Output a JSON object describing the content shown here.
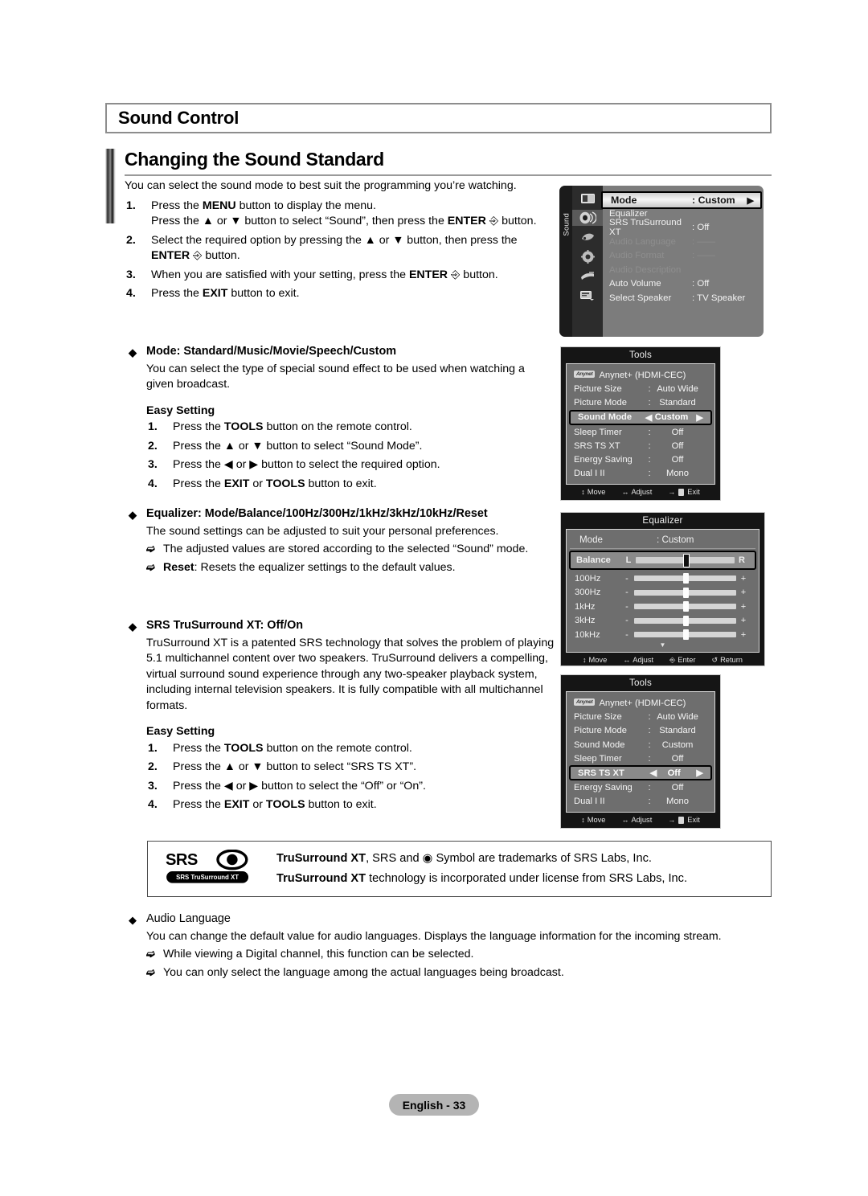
{
  "section": {
    "title": "Sound Control",
    "subtitle": "Changing the Sound Standard"
  },
  "intro": {
    "line": "You can select the sound mode to best suit the programming you’re watching.",
    "steps": [
      {
        "num": "1.",
        "line1_a": "Press the ",
        "line1_b": "MENU",
        "line1_c": " button to display the menu.",
        "line2_a": "Press the ▲ or ▼ button to select “Sound”, then press the ",
        "line2_b": "ENTER",
        "line2_c": " button."
      },
      {
        "num": "2.",
        "line1_a": "Select the required option by pressing the ▲ or ▼ button, then press the",
        "line2_b": "ENTER",
        "line2_c": " button."
      },
      {
        "num": "3.",
        "line1_a": "When you are satisfied with your setting, press the ",
        "line1_b": "ENTER",
        "line1_c": " button."
      },
      {
        "num": "4.",
        "line1_a": "Press the ",
        "line1_b": "EXIT",
        "line1_c": " button to exit."
      }
    ]
  },
  "bullets": {
    "mode": {
      "heading": "Mode: Standard/Music/Movie/Speech/Custom",
      "body": "You can select the type of special sound effect to be used when watching a given broadcast.",
      "easy_setting_label": "Easy Setting",
      "steps": [
        {
          "num": "1.",
          "a": "Press the ",
          "b": "TOOLS",
          "c": " button on the remote control."
        },
        {
          "num": "2.",
          "a": "Press the ▲ or ▼ button to select “Sound Mode”.",
          "b": "",
          "c": ""
        },
        {
          "num": "3.",
          "a": "Press the ◀ or ▶ button to select the required option.",
          "b": "",
          "c": ""
        },
        {
          "num": "4.",
          "a": "Press the ",
          "b": "EXIT",
          "mid": " or ",
          "b2": "TOOLS",
          "c": " button to exit."
        }
      ]
    },
    "equalizer": {
      "heading": "Equalizer: Mode/Balance/100Hz/300Hz/1kHz/3kHz/10kHz/Reset",
      "body": "The sound settings can be adjusted to suit your personal preferences.",
      "notes": [
        {
          "bold": "",
          "text": "The adjusted values are stored according to the selected “Sound” mode."
        },
        {
          "bold": "Reset",
          "text": ": Resets the equalizer settings to the default values."
        }
      ]
    },
    "srs": {
      "heading": "SRS TruSurround XT: Off/On",
      "body": "TruSurround XT is a patented SRS technology that solves the problem of playing 5.1 multichannel content over two speakers. TruSurround delivers a compelling, virtual surround sound experience through any two-speaker playback system, including internal television speakers. It is fully compatible with all multichannel formats.",
      "easy_setting_label": "Easy Setting",
      "steps": [
        {
          "num": "1.",
          "a": "Press the ",
          "b": "TOOLS",
          "c": " button on the remote control."
        },
        {
          "num": "2.",
          "a": "Press the ▲ or ▼ button to select “SRS TS XT”.",
          "b": "",
          "c": ""
        },
        {
          "num": "3.",
          "a": "Press the ◀ or ▶ button to select the “Off” or “On”.",
          "b": "",
          "c": ""
        },
        {
          "num": "4.",
          "a": "Press the ",
          "b": "EXIT",
          "mid": " or ",
          "b2": "TOOLS",
          "c": " button to exit."
        }
      ]
    },
    "audio_language": {
      "heading": "Audio Language",
      "body": "You can change the default value for audio languages. Displays the language information for the incoming stream.",
      "notes": [
        {
          "text": "While viewing a Digital channel, this function can be selected."
        },
        {
          "text": "You can only select the language among the actual languages being broadcast."
        }
      ]
    }
  },
  "srs_box": {
    "logo_top": "SRS",
    "logo_bottom": "SRS TruSurround XT",
    "line1_a": "TruSurround XT",
    "line1_b": ", SRS and ",
    "line1_c": " Symbol are trademarks of SRS Labs, Inc.",
    "line2_a": "TruSurround XT",
    "line2_b": " technology is incorporated under license from SRS Labs, Inc."
  },
  "osd": {
    "sound_menu": {
      "rail_label": "Sound",
      "rail_icons": [
        "picture-icon",
        "sound-icon",
        "channel-icon",
        "setup-icon",
        "input-icon",
        "support-icon"
      ],
      "rows": [
        {
          "label": "Mode",
          "value": ": Custom",
          "state": "highlight",
          "arrow": "▶"
        },
        {
          "label": "Equalizer",
          "value": "",
          "state": "normal"
        },
        {
          "label": "SRS TruSurround XT",
          "value": ": Off",
          "state": "normal"
        },
        {
          "label": "Audio Language",
          "value": ": ——",
          "state": "dim"
        },
        {
          "label": "Audio Format",
          "value": ": ——",
          "state": "dim"
        },
        {
          "label": "Audio Description",
          "value": "",
          "state": "dim"
        },
        {
          "label": "Auto Volume",
          "value": ": Off",
          "state": "normal"
        },
        {
          "label": "Select Speaker",
          "value": ": TV Speaker",
          "state": "normal"
        }
      ]
    },
    "tools_1": {
      "title": "Tools",
      "anynet_chip": "Anynet",
      "anynet_label": "Anynet+ (HDMI-CEC)",
      "rows": [
        {
          "label": "Picture Size",
          "sep": ":",
          "value": "Auto Wide",
          "state": "normal"
        },
        {
          "label": "Picture Mode",
          "sep": ":",
          "value": "Standard",
          "state": "normal"
        },
        {
          "label": "Sound Mode",
          "sep": "◀",
          "value": "Custom",
          "state": "selected",
          "right": "▶"
        },
        {
          "label": "Sleep Timer",
          "sep": ":",
          "value": "Off",
          "state": "normal"
        },
        {
          "label": "SRS TS XT",
          "sep": ":",
          "value": "Off",
          "state": "normal"
        },
        {
          "label": "Energy Saving",
          "sep": ":",
          "value": "Off",
          "state": "normal"
        },
        {
          "label": "Dual I II",
          "sep": ":",
          "value": "Mono",
          "state": "normal"
        }
      ],
      "footer": [
        {
          "glyph": "⬍",
          "label": "Move"
        },
        {
          "glyph": "⬌",
          "label": "Adjust"
        },
        {
          "glyph": "→",
          "label": "Exit"
        }
      ]
    },
    "equalizer": {
      "title": "Equalizer",
      "mode_label": "Mode",
      "mode_value": ": Custom",
      "balance": {
        "label": "Balance",
        "left": "L",
        "right": "R",
        "position": 50
      },
      "bands": [
        {
          "label": "100Hz",
          "minus": "-",
          "plus": "+",
          "position": 50
        },
        {
          "label": "300Hz",
          "minus": "-",
          "plus": "+",
          "position": 50
        },
        {
          "label": "1kHz",
          "minus": "-",
          "plus": "+",
          "position": 50
        },
        {
          "label": "3kHz",
          "minus": "-",
          "plus": "+",
          "position": 50
        },
        {
          "label": "10kHz",
          "minus": "-",
          "plus": "+",
          "position": 50
        }
      ],
      "scroll_down": "▼",
      "footer": [
        {
          "glyph": "⬍",
          "label": "Move"
        },
        {
          "glyph": "⬌",
          "label": "Adjust"
        },
        {
          "glyph": "↵",
          "label": "Enter"
        },
        {
          "glyph": "↺",
          "label": "Return"
        }
      ]
    },
    "tools_2": {
      "title": "Tools",
      "anynet_chip": "Anynet",
      "anynet_label": "Anynet+ (HDMI-CEC)",
      "rows": [
        {
          "label": "Picture Size",
          "sep": ":",
          "value": "Auto Wide",
          "state": "normal"
        },
        {
          "label": "Picture Mode",
          "sep": ":",
          "value": "Standard",
          "state": "normal"
        },
        {
          "label": "Sound Mode",
          "sep": ":",
          "value": "Custom",
          "state": "normal"
        },
        {
          "label": "Sleep Timer",
          "sep": ":",
          "value": "Off",
          "state": "normal"
        },
        {
          "label": "SRS TS XT",
          "sep": "◀",
          "value": "Off",
          "state": "selected",
          "right": "▶"
        },
        {
          "label": "Energy Saving",
          "sep": ":",
          "value": "Off",
          "state": "normal"
        },
        {
          "label": "Dual I II",
          "sep": ":",
          "value": "Mono",
          "state": "normal"
        }
      ],
      "footer": [
        {
          "glyph": "⬍",
          "label": "Move"
        },
        {
          "glyph": "⬌",
          "label": "Adjust"
        },
        {
          "glyph": "→",
          "label": "Exit"
        }
      ]
    }
  },
  "footer": {
    "page_label": "English - 33"
  }
}
